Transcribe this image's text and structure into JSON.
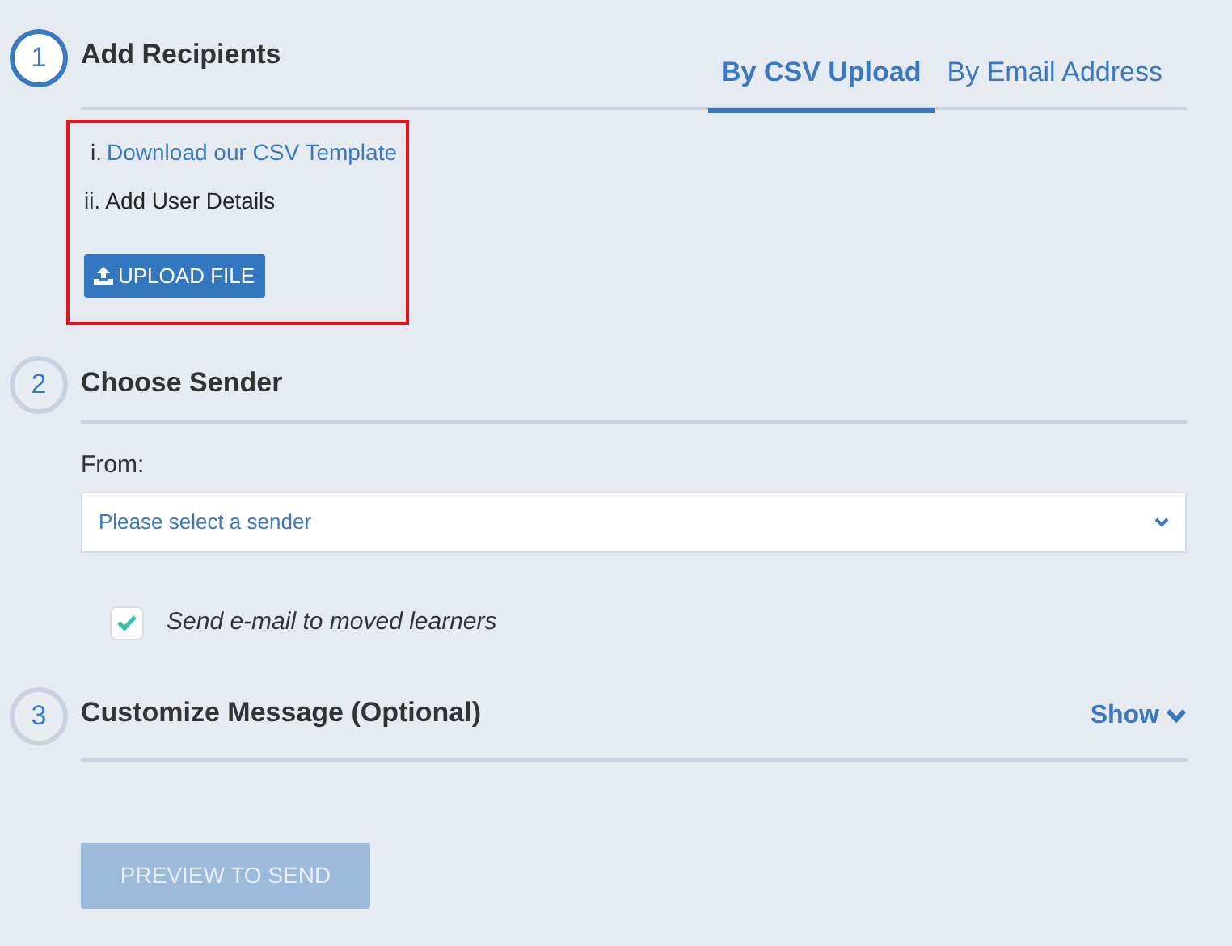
{
  "steps": [
    {
      "kind": "recipients",
      "number": "1",
      "title": "Add Recipients",
      "active": true,
      "tabs": [
        {
          "label": "By CSV Upload",
          "selected": true
        },
        {
          "label": "By Email Address",
          "selected": false
        }
      ],
      "highlighted": true,
      "instructions": [
        {
          "kind": "link",
          "marker": "i.",
          "text": "Download our CSV Template"
        },
        {
          "kind": "text",
          "marker": "ii.",
          "text": "Add User Details"
        }
      ],
      "upload_button": "UPLOAD FILE"
    },
    {
      "kind": "sender",
      "number": "2",
      "title": "Choose Sender",
      "active": false,
      "from_label": "From:",
      "select": {
        "placeholder": "Please select a sender"
      },
      "checkbox": {
        "label": "Send e-mail to moved learners",
        "checked": true
      }
    },
    {
      "kind": "message",
      "number": "3",
      "title": "Customize Message (Optional)",
      "active": false,
      "toggle": {
        "label": "Show",
        "expanded": false
      }
    }
  ],
  "preview_button": {
    "label": "PREVIEW TO SEND",
    "disabled": true
  }
}
